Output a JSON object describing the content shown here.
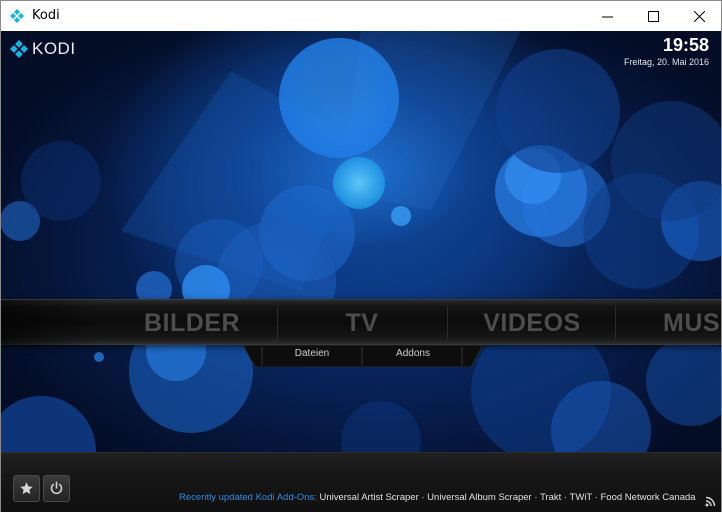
{
  "window": {
    "title": "Kodi",
    "icons": {
      "app": "kodi-logo-icon",
      "minimize": "minimize-icon",
      "maximize": "maximize-icon",
      "close": "close-icon"
    }
  },
  "header": {
    "logo_text": "KODI",
    "time": "19:58",
    "date": "Freitag, 20. Mai 2016"
  },
  "main_menu": {
    "items": [
      {
        "label": "BILDER"
      },
      {
        "label": "TV"
      },
      {
        "label": "VIDEOS"
      },
      {
        "label": "MUSIK"
      }
    ],
    "submenu": [
      {
        "label": "Dateien"
      },
      {
        "label": "Addons"
      }
    ]
  },
  "footer": {
    "favourites_icon": "star-icon",
    "power_icon": "power-icon",
    "ticker_lead": "Recently updated Kodi Add-Ons:",
    "ticker_items": " Universal Artist Scraper · Universal Album Scraper · Trakt · TWiT · Food Network Canada",
    "rss_icon": "rss-icon"
  },
  "colors": {
    "accent_blue": "#2f8be0",
    "background_blue": "#0b3a86",
    "menu_text": "#4d4d4d"
  }
}
